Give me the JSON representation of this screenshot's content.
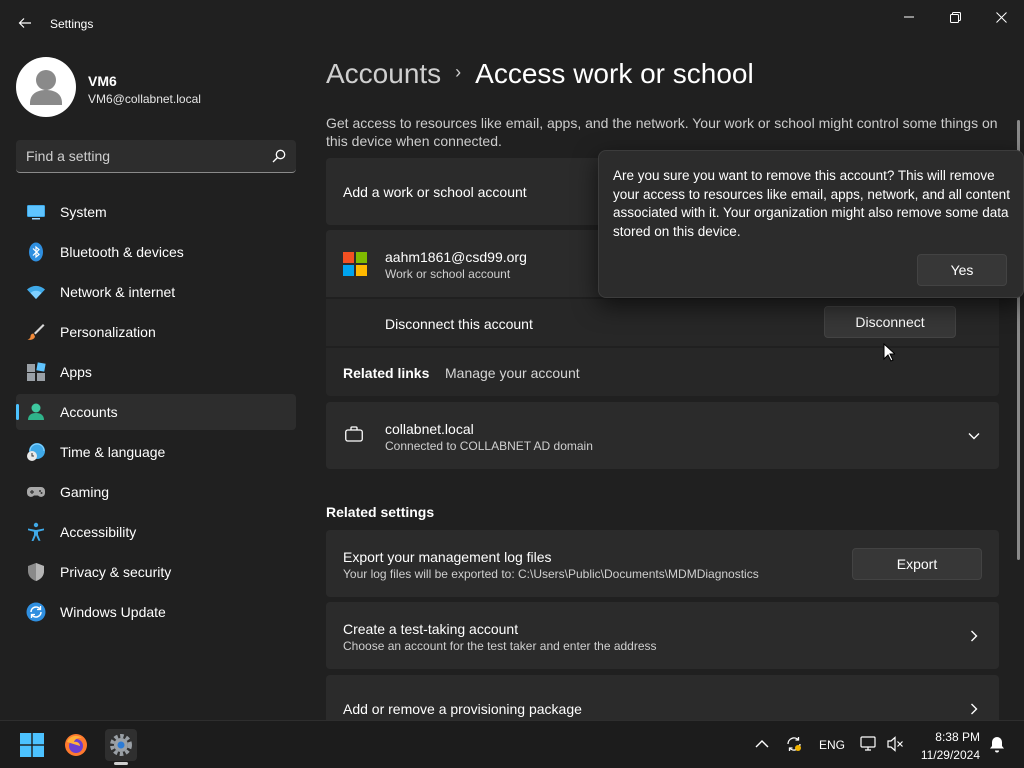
{
  "window": {
    "app_title": "Settings"
  },
  "profile": {
    "name": "VM6",
    "email": "VM6@collabnet.local"
  },
  "search": {
    "placeholder": "Find a setting"
  },
  "nav": {
    "items": [
      {
        "label": "System",
        "icon": "system-icon"
      },
      {
        "label": "Bluetooth & devices",
        "icon": "bluetooth-icon"
      },
      {
        "label": "Network & internet",
        "icon": "wifi-icon"
      },
      {
        "label": "Personalization",
        "icon": "brush-icon"
      },
      {
        "label": "Apps",
        "icon": "apps-icon"
      },
      {
        "label": "Accounts",
        "icon": "accounts-icon",
        "selected": true
      },
      {
        "label": "Time & language",
        "icon": "time-language-icon"
      },
      {
        "label": "Gaming",
        "icon": "gamepad-icon"
      },
      {
        "label": "Accessibility",
        "icon": "accessibility-icon"
      },
      {
        "label": "Privacy & security",
        "icon": "shield-icon"
      },
      {
        "label": "Windows Update",
        "icon": "windows-update-icon"
      }
    ]
  },
  "breadcrumb": {
    "parent": "Accounts",
    "separator": "›",
    "current": "Access work or school"
  },
  "description": "Get access to resources like email, apps, and the network. Your work or school might control some things on this device when connected.",
  "add_account": {
    "label": "Add a work or school account"
  },
  "account": {
    "email": "aahm1861@csd99.org",
    "type": "Work or school account",
    "disconnect_label": "Disconnect this account",
    "disconnect_button": "Disconnect",
    "related_links_label": "Related links",
    "manage_link": "Manage your account"
  },
  "domain": {
    "name": "collabnet.local",
    "status": "Connected to COLLABNET AD domain"
  },
  "related_settings": {
    "title": "Related settings",
    "export": {
      "title": "Export your management log files",
      "subtitle": "Your log files will be exported to: C:\\Users\\Public\\Documents\\MDMDiagnostics",
      "button": "Export"
    },
    "test_account": {
      "title": "Create a test-taking account",
      "subtitle": "Choose an account for the test taker and enter the address"
    },
    "provisioning": {
      "title": "Add or remove a provisioning package"
    }
  },
  "flyout": {
    "message": "Are you sure you want to remove this account? This will remove your access to resources like email, apps, network, and all content associated with it. Your organization might also remove some data stored on this device.",
    "yes": "Yes"
  },
  "taskbar": {
    "language": "ENG",
    "time": "8:38 PM",
    "date": "11/29/2024"
  },
  "colors": {
    "accent": "#4cc2ff",
    "background": "#202020",
    "card": "#2b2b2b"
  }
}
